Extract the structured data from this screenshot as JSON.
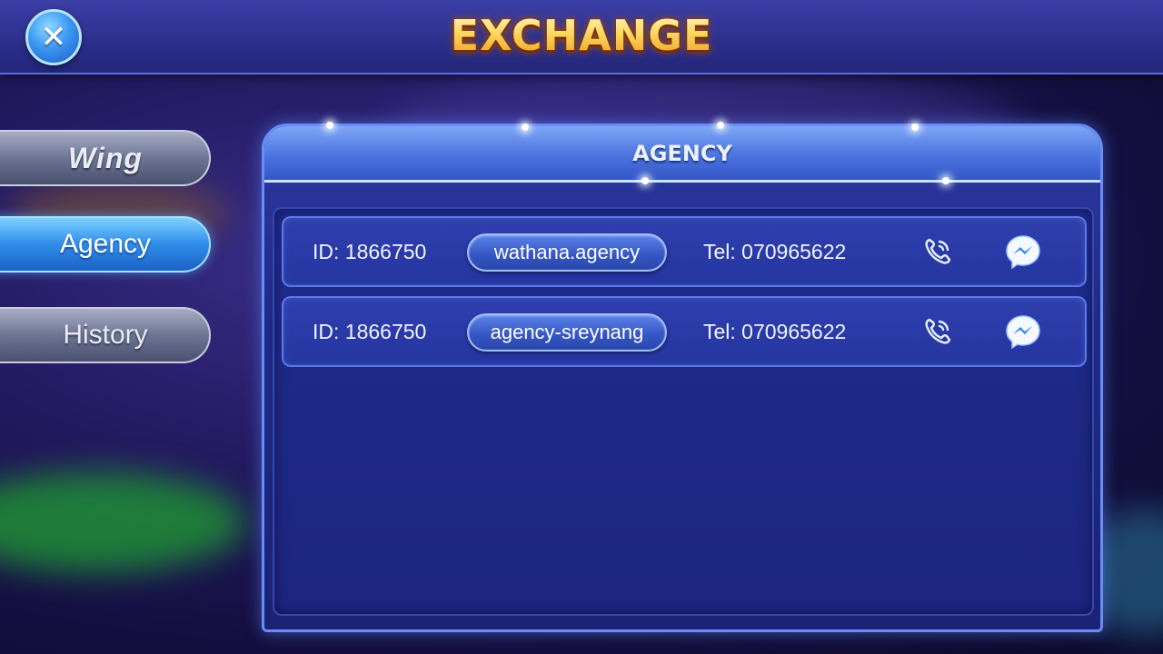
{
  "header": {
    "title": "EXCHANGE",
    "close_icon": "close-icon"
  },
  "sidebar": {
    "items": [
      {
        "label": "Wing",
        "state": "inactive",
        "style": "logo"
      },
      {
        "label": "Agency",
        "state": "active"
      },
      {
        "label": "History",
        "state": "inactive"
      }
    ]
  },
  "panel": {
    "title": "AGENCY",
    "rows": [
      {
        "id_text": "ID: 1866750",
        "name": "wathana.agency",
        "tel_text": "Tel: 070965622",
        "icons": [
          "phone-icon",
          "messenger-icon"
        ]
      },
      {
        "id_text": "ID: 1866750",
        "name": "agency-sreynang",
        "tel_text": "Tel: 070965622",
        "icons": [
          "phone-icon",
          "messenger-icon"
        ]
      }
    ]
  },
  "colors": {
    "accent_blue": "#2f8de8",
    "title_gold": "#ffd860",
    "panel_border": "#6a8cf5"
  }
}
